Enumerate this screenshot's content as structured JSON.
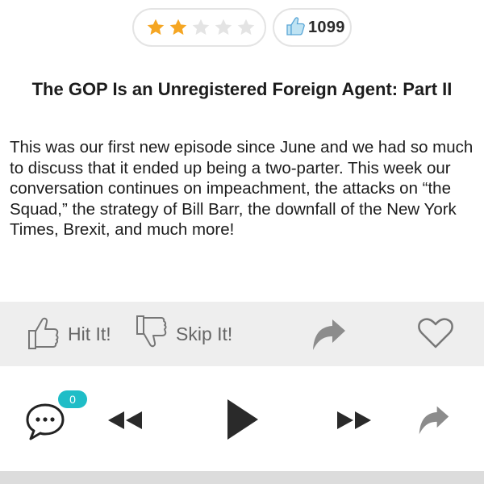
{
  "rating": {
    "value": 2,
    "max": 5,
    "filled_color": "#f5a623",
    "empty_color": "#e4e4e4"
  },
  "likes": {
    "icon": "thumbs-up-icon",
    "count": "1099"
  },
  "episode": {
    "title": "The GOP Is an Unregistered Foreign Agent: Part II",
    "description": "This was our first new episode since June and we had so much to discuss that it ended up being a two-parter. This week our conversation continues on impeachment, the attacks on “the Squad,” the strategy of Bill Barr, the downfall of the New York Times, Brexit, and much more!"
  },
  "actions": {
    "hit_label": "Hit It!",
    "skip_label": "Skip It!"
  },
  "player": {
    "comment_count": "0",
    "accent": "#1fbdc7"
  },
  "progress": {
    "value": 0
  }
}
